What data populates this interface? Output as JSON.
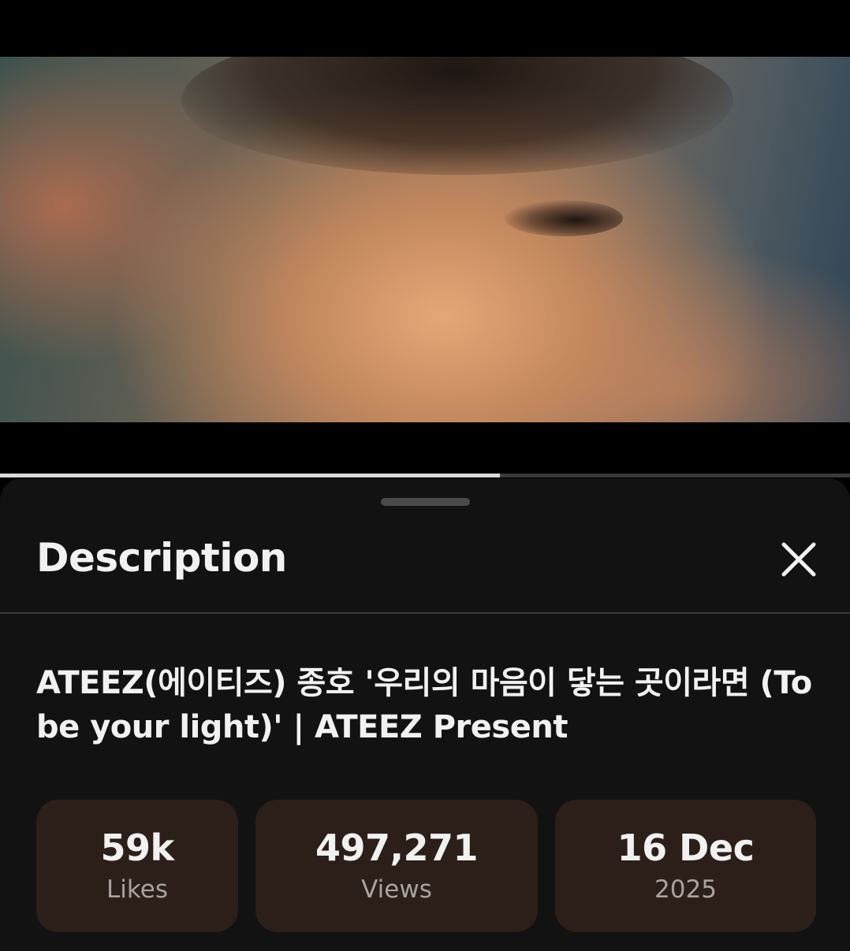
{
  "player": {
    "progress_fraction": 0.588,
    "colors": {
      "progress_played": "#d9d9d9",
      "progress_track": "#3a3a3a"
    }
  },
  "description_sheet": {
    "title": "Description",
    "close_icon": "close-icon",
    "video_title": "ATEEZ(에이티즈) 종호 '우리의 마음이 닿는 곳이라면 (To be your light)' | ATEEZ Present",
    "stats": [
      {
        "value": "59k",
        "label": "Likes"
      },
      {
        "value": "497,271",
        "label": "Views"
      },
      {
        "value": "16 Dec",
        "label": "2025"
      }
    ],
    "colors": {
      "background": "#121212",
      "stat_background": "#2c1f1a",
      "text_primary": "#f1f1f1",
      "text_secondary": "#a9a3a0"
    }
  }
}
